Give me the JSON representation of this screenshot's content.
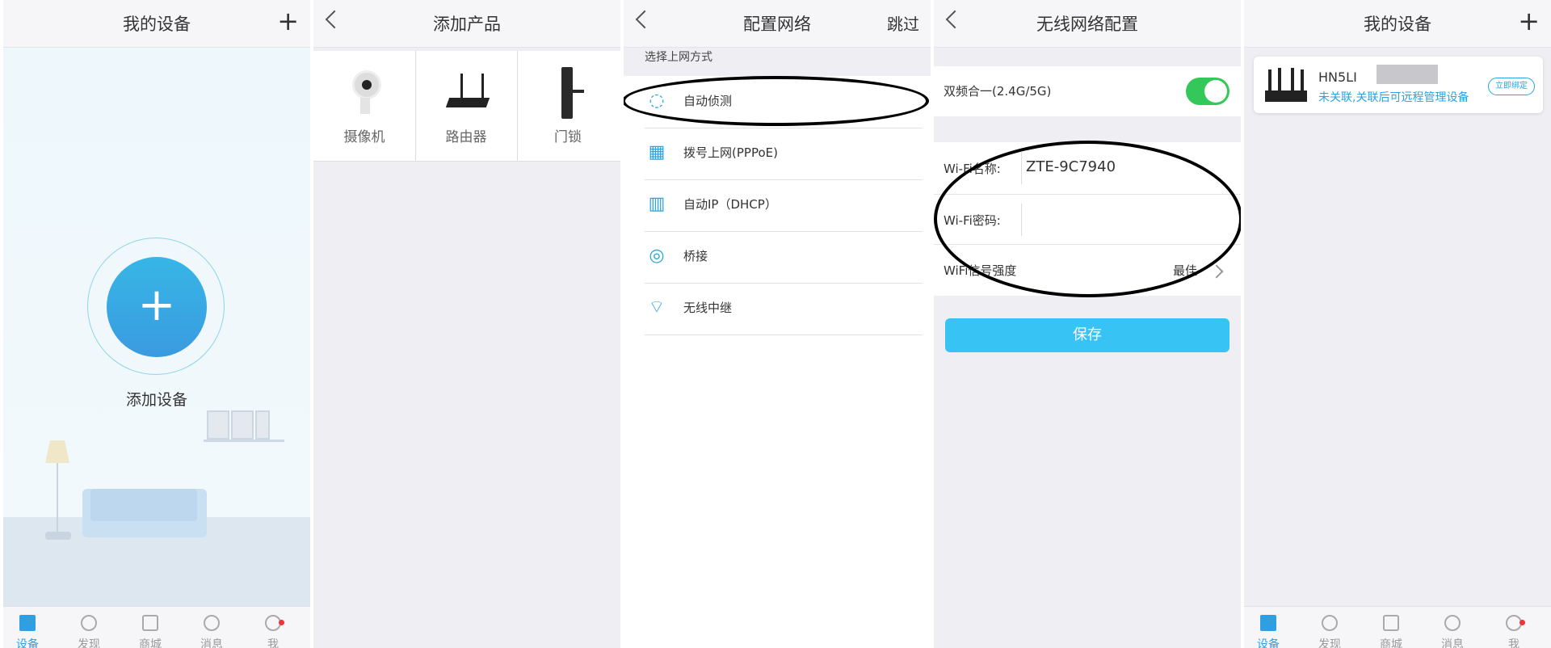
{
  "panel1": {
    "title": "我的设备",
    "plus": "+",
    "add_button": "+",
    "add_label": "添加设备"
  },
  "panel2": {
    "title": "添加产品",
    "products": [
      {
        "label": "摄像机"
      },
      {
        "label": "路由器"
      },
      {
        "label": "门锁"
      }
    ]
  },
  "panel3": {
    "title": "配置网络",
    "skip": "跳过",
    "section_label": "选择上网方式",
    "methods": [
      {
        "label": "自动侦测",
        "icon": "auto-detect-icon"
      },
      {
        "label": "拨号上网(PPPoE)",
        "icon": "keypad-icon"
      },
      {
        "label": "自动IP（DHCP）",
        "icon": "ip-icon"
      },
      {
        "label": "桥接",
        "icon": "bridge-icon"
      },
      {
        "label": "无线中继",
        "icon": "wireless-repeater-icon"
      }
    ]
  },
  "panel4": {
    "title": "无线网络配置",
    "dual_band_label": "双频合一(2.4G/5G)",
    "dual_band_on": true,
    "wifi_name_label": "Wi-Fi名称:",
    "wifi_name_value": "ZTE-9C7940",
    "wifi_password_label": "Wi-Fi密码:",
    "signal_label": "WiFi信号强度",
    "signal_value": "最佳",
    "save": "保存"
  },
  "panel5": {
    "title": "我的设备",
    "plus": "+",
    "device_name": "HN5LI",
    "device_status": "未关联,关联后可远程管理设备",
    "bind_button": "立即绑定"
  },
  "tabbar": {
    "tabs": [
      {
        "label": "设备",
        "icon": "device-icon"
      },
      {
        "label": "发现",
        "icon": "discover-icon"
      },
      {
        "label": "商城",
        "icon": "shop-bag-icon"
      },
      {
        "label": "消息",
        "icon": "message-icon"
      },
      {
        "label": "我",
        "icon": "profile-icon"
      }
    ]
  },
  "colors": {
    "accent": "#2f9fe0",
    "save_button": "#38c3f5",
    "toggle_on": "#34c759",
    "badge": "#ee3333"
  }
}
